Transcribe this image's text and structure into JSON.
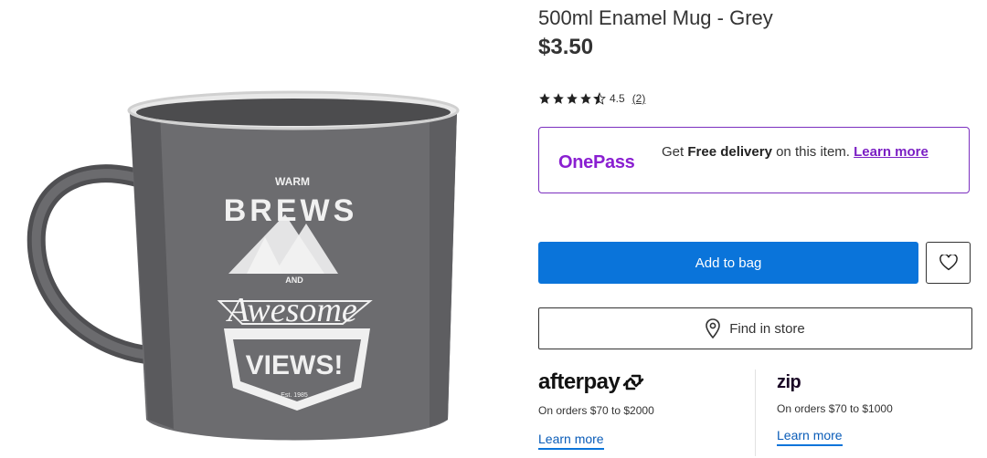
{
  "product": {
    "title": "500ml Enamel Mug - Grey",
    "price": "$3.50",
    "rating": 4.5,
    "rating_text": "4.5",
    "review_count": "(2)",
    "image_text": {
      "line1": "WARM",
      "line2": "BREWS",
      "line3": "AND",
      "line4": "Awesome",
      "line5": "VIEWS!",
      "line6": "Est. 1985"
    }
  },
  "onepass": {
    "logo": "OnePass",
    "text_prefix": "Get",
    "text_bold": "Free delivery",
    "text_suffix": "on this item.",
    "link": "Learn more"
  },
  "actions": {
    "add_to_bag": "Add to bag",
    "find_in_store": "Find in store"
  },
  "afterpay": {
    "brand": "afterpay",
    "note": "On orders $70 to $2000",
    "link": "Learn more"
  },
  "zip": {
    "brand": "zip",
    "note": "On orders $70 to $1000",
    "link": "Learn more"
  },
  "colors": {
    "primary": "#0a74da",
    "onepass_purple": "#8a1fd1",
    "mug_grey": "#6d6d6f"
  }
}
